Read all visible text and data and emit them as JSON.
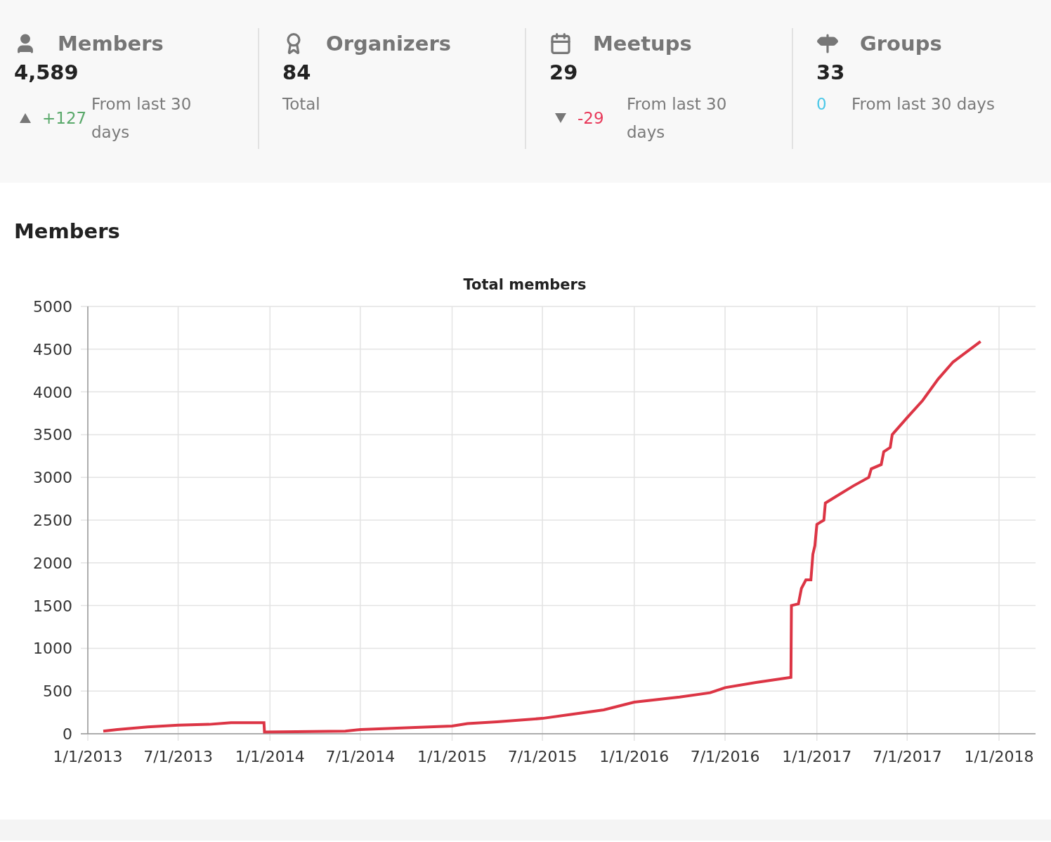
{
  "stats": [
    {
      "title": "Members",
      "value": "4,589",
      "change": {
        "kind": "up",
        "value": "+127",
        "note": "From last 30 days"
      }
    },
    {
      "title": "Organizers",
      "value": "84",
      "note": "Total"
    },
    {
      "title": "Meetups",
      "value": "29",
      "change": {
        "kind": "down",
        "value": "-29",
        "note": "From last 30 days"
      }
    },
    {
      "title": "Groups",
      "value": "33",
      "change": {
        "kind": "none",
        "value": "0",
        "note": "From last 30 days"
      }
    }
  ],
  "members_section": {
    "heading": "Members",
    "chart_data": {
      "type": "line",
      "title": "Total members",
      "xticks": [
        {
          "value": "2013-01-01",
          "label": "1/1/2013"
        },
        {
          "value": "2013-07-01",
          "label": "7/1/2013"
        },
        {
          "value": "2014-01-01",
          "label": "1/1/2014"
        },
        {
          "value": "2014-07-01",
          "label": "7/1/2014"
        },
        {
          "value": "2015-01-01",
          "label": "1/1/2015"
        },
        {
          "value": "2015-07-01",
          "label": "7/1/2015"
        },
        {
          "value": "2016-01-01",
          "label": "1/1/2016"
        },
        {
          "value": "2016-07-01",
          "label": "7/1/2016"
        },
        {
          "value": "2017-01-01",
          "label": "1/1/2017"
        },
        {
          "value": "2017-07-01",
          "label": "7/1/2017"
        },
        {
          "value": "2018-01-01",
          "label": "1/1/2018"
        }
      ],
      "yticks": [
        0,
        500,
        1000,
        1500,
        2000,
        2500,
        3000,
        3500,
        4000,
        4500,
        5000
      ],
      "ylim": [
        0,
        5000
      ],
      "xlim": [
        "2013-01-01",
        "2018-01-01"
      ],
      "grid": true,
      "x": [
        "2013-02-01",
        "2013-03-01",
        "2013-05-01",
        "2013-07-01",
        "2013-09-01",
        "2013-10-15",
        "2013-12-20",
        "2013-12-21",
        "2014-06-01",
        "2014-07-01",
        "2014-10-01",
        "2015-01-01",
        "2015-02-01",
        "2015-04-01",
        "2015-07-01",
        "2015-09-01",
        "2015-11-01",
        "2016-01-01",
        "2016-04-01",
        "2016-06-01",
        "2016-07-01",
        "2016-09-01",
        "2016-11-10",
        "2016-11-11",
        "2016-11-25",
        "2016-12-01",
        "2016-12-10",
        "2016-12-20",
        "2016-12-24",
        "2016-12-28",
        "2017-01-01",
        "2017-01-15",
        "2017-01-18",
        "2017-02-15",
        "2017-03-15",
        "2017-04-15",
        "2017-04-20",
        "2017-05-10",
        "2017-05-15",
        "2017-05-28",
        "2017-06-01",
        "2017-07-01",
        "2017-08-01",
        "2017-09-01",
        "2017-10-01",
        "2017-11-25"
      ],
      "series": [
        {
          "color": "#dc3545",
          "values": [
            30,
            50,
            80,
            100,
            110,
            130,
            130,
            20,
            30,
            50,
            70,
            90,
            120,
            140,
            180,
            230,
            280,
            370,
            430,
            480,
            540,
            600,
            660,
            1500,
            1520,
            1700,
            1800,
            1800,
            2100,
            2200,
            2450,
            2500,
            2700,
            2800,
            2900,
            3000,
            3100,
            3150,
            3300,
            3350,
            3500,
            3700,
            3900,
            4150,
            4350,
            4590
          ]
        }
      ]
    }
  }
}
